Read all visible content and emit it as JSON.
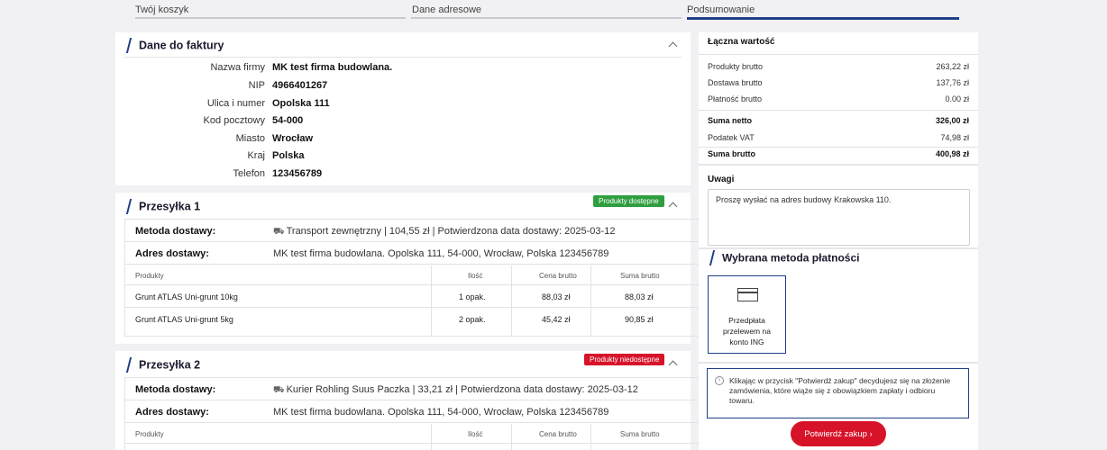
{
  "steps": [
    {
      "label": "Twój koszyk"
    },
    {
      "label": "Dane adresowe"
    },
    {
      "label": "Podsumowanie"
    }
  ],
  "invoice": {
    "title": "Dane do faktury",
    "rows": [
      {
        "label": "Nazwa firmy",
        "value": "MK test firma budowlana."
      },
      {
        "label": "NIP",
        "value": "4966401267"
      },
      {
        "label": "Ulica i numer",
        "value": "Opolska 111"
      },
      {
        "label": "Kod pocztowy",
        "value": "54-000"
      },
      {
        "label": "Miasto",
        "value": "Wrocław"
      },
      {
        "label": "Kraj",
        "value": "Polska"
      },
      {
        "label": "Telefon",
        "value": "123456789"
      }
    ]
  },
  "shipments": [
    {
      "title": "Przesyłka 1",
      "badge": "Produkty dostępne",
      "method_label": "Metoda dostawy:",
      "method_value": "Transport zewnętrzny | 104,55 zł | Potwierdzona data dostawy: 2025-03-12",
      "address_label": "Adres dostawy:",
      "address_value": "MK test firma budowlana. Opolska 111, 54-000, Wrocław, Polska 123456789",
      "columns": [
        "Produkty",
        "Ilość",
        "Cena brutto",
        "Suma brutto"
      ],
      "items": [
        {
          "name": "Grunt ATLAS Uni-grunt 10kg",
          "qty": "1 opak.",
          "price": "88,03 zł",
          "sum": "88,03 zł"
        },
        {
          "name": "Grunt ATLAS Uni-grunt 5kg",
          "qty": "2 opak.",
          "price": "45,42 zł",
          "sum": "90,85 zł"
        }
      ]
    },
    {
      "title": "Przesyłka 2",
      "badge": "Produkty niedostępne",
      "method_label": "Metoda dostawy:",
      "method_value": "Kurier Rohling Suus Paczka | 33,21 zł | Potwierdzona data dostawy: 2025-03-12",
      "address_label": "Adres dostawy:",
      "address_value": "MK test firma budowlana. Opolska 111, 54-000, Wrocław, Polska 123456789",
      "columns": [
        "Produkty",
        "Ilość",
        "Cena brutto",
        "Suma brutto"
      ]
    }
  ],
  "summary": {
    "title": "Łączna wartość",
    "rows": [
      {
        "label": "Produkty brutto",
        "value": "263,22 zł"
      },
      {
        "label": "Dostawa brutto",
        "value": "137,76 zł"
      },
      {
        "label": "Płatność brutto",
        "value": "0.00 zł"
      },
      {
        "label": "Suma netto",
        "value": "326,00 zł"
      },
      {
        "label": "Podatek VAT",
        "value": "74,98 zł"
      },
      {
        "label": "Suma brutto",
        "value": "400,98 zł"
      }
    ]
  },
  "notes": {
    "title": "Uwagi",
    "value": "Proszę wysłać na adres budowy Krakowska 110."
  },
  "payment": {
    "title": "Wybrana metoda płatności",
    "option_label": "Przedpłata przelewem na konto ING"
  },
  "info": {
    "text": "Klikając w przycisk \"Potwierdź zakup\" decydujesz się na złożenie zamówienia, które wiąże się z obowiązkiem zapłaty i odbioru towaru."
  },
  "confirm": {
    "label": "Potwierdź zakup",
    "arrow": "›"
  },
  "colors": {
    "accent": "#1f3f87",
    "success": "#2e9e3e",
    "danger": "#d7132a"
  }
}
